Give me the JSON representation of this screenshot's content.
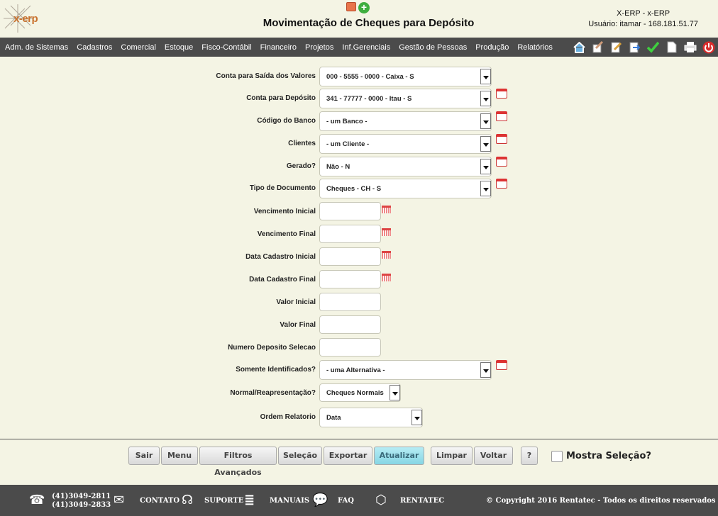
{
  "header": {
    "logo_text": "x-erp",
    "title": "Movimentação de Cheques para Depósito",
    "system": "X-ERP - x-ERP",
    "user": "Usuário: itamar - 168.181.51.77"
  },
  "menu": [
    "Adm. de Sistemas",
    "Cadastros",
    "Comercial",
    "Estoque",
    "Fisco-Contábil",
    "Financeiro",
    "Projetos",
    "Inf.Gerenciais",
    "Gestão de Pessoas",
    "Produção",
    "Relatórios"
  ],
  "toolbar_icons": [
    "home-icon",
    "edit-list-icon",
    "edit-icon",
    "export-icon",
    "check-icon",
    "document-icon",
    "print-icon",
    "power-icon"
  ],
  "form": {
    "conta_saida": {
      "label": "Conta para Saída dos Valores",
      "value": "000 - 5555 - 0000 - Caixa - S"
    },
    "conta_deposito": {
      "label": "Conta para Depósito",
      "value": "341 - 77777 - 0000 - Itau - S"
    },
    "codigo_banco": {
      "label": "Código do Banco",
      "value": "- um Banco -"
    },
    "clientes": {
      "label": "Clientes",
      "value": "- um Cliente -"
    },
    "gerado": {
      "label": "Gerado?",
      "value": "Não - N"
    },
    "tipo_documento": {
      "label": "Tipo de Documento",
      "value": "Cheques - CH - S"
    },
    "venc_inicial": {
      "label": "Vencimento Inicial",
      "value": ""
    },
    "venc_final": {
      "label": "Vencimento Final",
      "value": ""
    },
    "data_cad_inicial": {
      "label": "Data Cadastro Inicial",
      "value": ""
    },
    "data_cad_final": {
      "label": "Data Cadastro Final",
      "value": ""
    },
    "valor_inicial": {
      "label": "Valor Inicial",
      "value": ""
    },
    "valor_final": {
      "label": "Valor Final",
      "value": ""
    },
    "numero_deposito": {
      "label": "Numero Deposito Selecao",
      "value": ""
    },
    "somente_ident": {
      "label": "Somente Identificados?",
      "value": "- uma Alternativa -"
    },
    "normal_reap": {
      "label": "Normal/Reapresentação?",
      "value": "Cheques Normais"
    },
    "ordem_relatorio": {
      "label": "Ordem Relatorio",
      "value": "Data"
    }
  },
  "buttons": {
    "sair": "Sair",
    "menu": "Menu",
    "filtros": "Filtros Avançados",
    "selecao": "Seleção",
    "exportar": "Exportar",
    "atualizar": "Atualizar",
    "limpar": "Limpar",
    "voltar": "Voltar",
    "help": "?"
  },
  "mostra_selecao": "Mostra Seleção?",
  "footer": {
    "phone1": "(41)3049-2811",
    "phone2": "(41)3049-2833",
    "contato": "CONTATO",
    "suporte": "SUPORTE",
    "manuais": "MANUAIS",
    "faq": "FAQ",
    "rentatec": "RENTATEC",
    "copyright": "© Copyright 2016 Rentatec - Todos os direitos reservados"
  },
  "colors": {
    "background": "#f4f4e4",
    "menubar": "#4b4b4b",
    "active_button": "#9fe2ee"
  }
}
